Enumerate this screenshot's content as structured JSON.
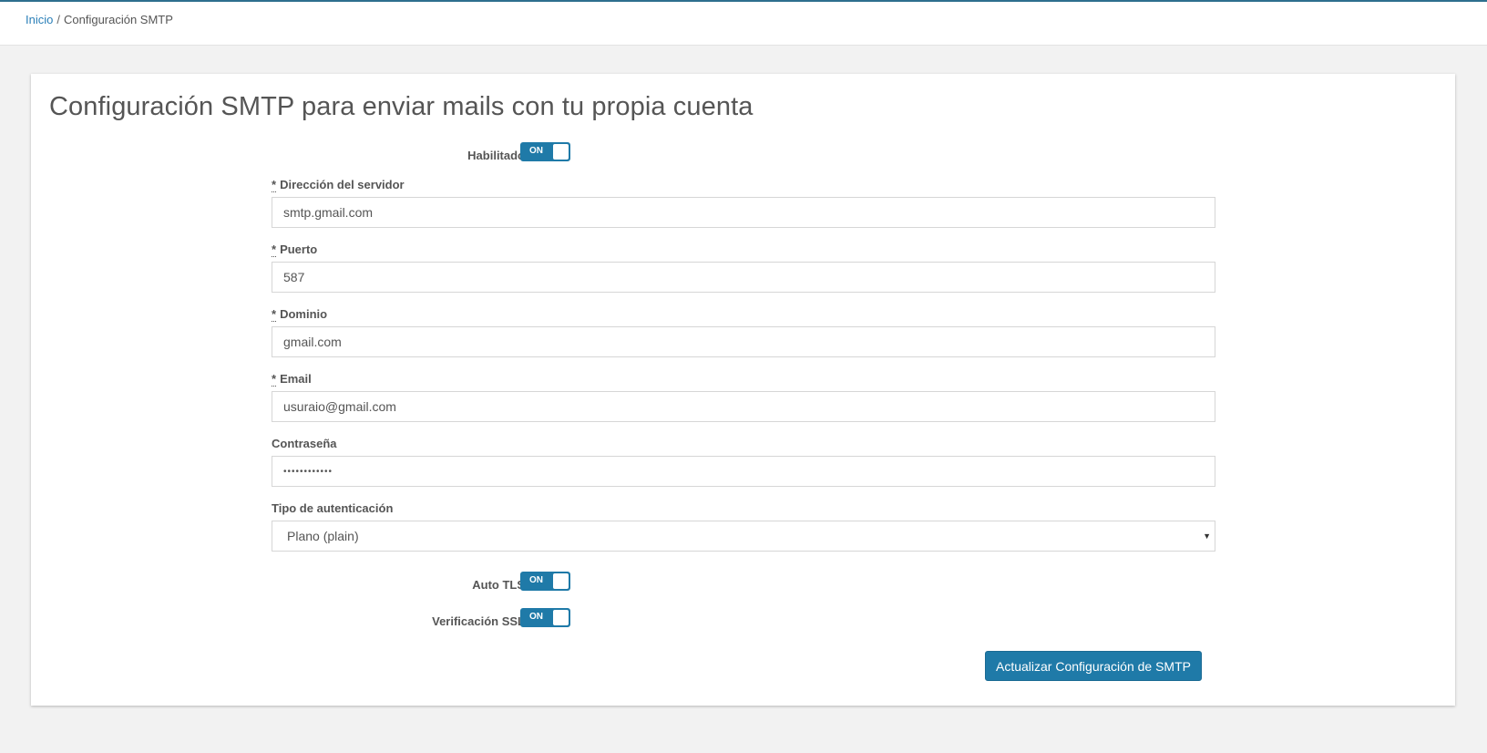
{
  "breadcrumb": {
    "home": "Inicio",
    "separator": "/",
    "current": "Configuración SMTP"
  },
  "page": {
    "title": "Configuración SMTP para enviar mails con tu propia cuenta"
  },
  "form": {
    "enabled": {
      "label": "Habilitado",
      "state": "ON"
    },
    "server": {
      "required": "*",
      "label": "Dirección del servidor",
      "value": "smtp.gmail.com"
    },
    "port": {
      "required": "*",
      "label": "Puerto",
      "value": "587"
    },
    "domain": {
      "required": "*",
      "label": "Dominio",
      "value": "gmail.com"
    },
    "email": {
      "required": "*",
      "label": "Email",
      "value": "usuraio@gmail.com"
    },
    "password": {
      "label": "Contraseña",
      "value": "••••••••••••"
    },
    "auth_type": {
      "label": "Tipo de autenticación",
      "selected": "Plano (plain)",
      "caret": "▼"
    },
    "auto_tls": {
      "label": "Auto TLS",
      "state": "ON"
    },
    "ssl_verify": {
      "label": "Verificación SSL",
      "state": "ON"
    },
    "submit_label": "Actualizar Configuración de SMTP"
  },
  "colors": {
    "accent": "#1f7aa8",
    "link": "#2a7fb8"
  }
}
